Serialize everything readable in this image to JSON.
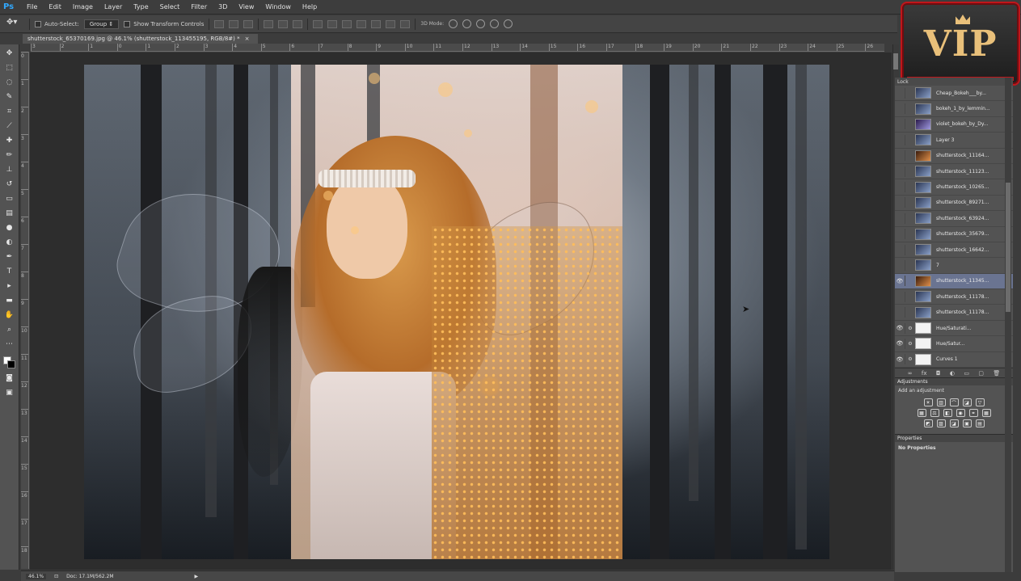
{
  "app": {
    "logo": "Ps"
  },
  "menu": [
    "File",
    "Edit",
    "Image",
    "Layer",
    "Type",
    "Select",
    "Filter",
    "3D",
    "View",
    "Window",
    "Help"
  ],
  "options": {
    "auto_select_label": "Auto-Select:",
    "auto_select_value": "Group",
    "show_transform_label": "Show Transform Controls",
    "mode_3d_label": "3D Mode:"
  },
  "document": {
    "tab_title": "shutterstock_65370169.jpg @ 46.1% (shutterstock_113455195, RGB/8#) *"
  },
  "rulers": {
    "horizontal": [
      "3",
      "2",
      "1",
      "0",
      "1",
      "2",
      "3",
      "4",
      "5",
      "6",
      "7",
      "8",
      "9",
      "10",
      "11",
      "12",
      "13",
      "14",
      "15",
      "16",
      "17",
      "18",
      "19",
      "20",
      "21",
      "22",
      "23",
      "24",
      "25",
      "26"
    ],
    "vertical": [
      "0",
      "1",
      "2",
      "3",
      "4",
      "5",
      "6",
      "7",
      "8",
      "9",
      "10",
      "11",
      "12",
      "13",
      "14",
      "15",
      "16",
      "17",
      "18"
    ]
  },
  "layers": [
    {
      "name": "Cheap_Bokeh___by...",
      "visible": false,
      "thumb": "blue"
    },
    {
      "name": "bokeh_1_by_lemmin...",
      "visible": false,
      "thumb": "blue"
    },
    {
      "name": "violet_bokeh_by_Dy...",
      "visible": false,
      "thumb": "purple"
    },
    {
      "name": "Layer 3",
      "visible": false,
      "thumb": "blue"
    },
    {
      "name": "shutterstock_11164...",
      "visible": false,
      "thumb": "warm"
    },
    {
      "name": "shutterstock_11123...",
      "visible": false,
      "thumb": "blue"
    },
    {
      "name": "shutterstock_10265...",
      "visible": false,
      "thumb": "blue"
    },
    {
      "name": "shutterstock_89271...",
      "visible": false,
      "thumb": "blue"
    },
    {
      "name": "shutterstock_63924...",
      "visible": false,
      "thumb": "blue"
    },
    {
      "name": "shutterstock_35679...",
      "visible": false,
      "thumb": "blue"
    },
    {
      "name": "shutterstock_16642...",
      "visible": false,
      "thumb": "blue"
    },
    {
      "name": "7",
      "visible": false,
      "thumb": "blue"
    },
    {
      "name": "shutterstock_11345...",
      "visible": true,
      "thumb": "warm",
      "selected": true
    },
    {
      "name": "shutterstock_11178...",
      "visible": false,
      "thumb": "blue"
    },
    {
      "name": "shutterstock_11178...",
      "visible": false,
      "thumb": "blue"
    },
    {
      "name": "Hue/Saturati...",
      "visible": true,
      "thumb": "white",
      "adjustment": true
    },
    {
      "name": "Hue/Satur...",
      "visible": true,
      "thumb": "white",
      "adjustment": true
    },
    {
      "name": "Curves 1",
      "visible": true,
      "thumb": "white",
      "adjustment": true
    }
  ],
  "adjustments": {
    "title": "Adjustments",
    "subtitle": "Add an adjustment"
  },
  "properties": {
    "title": "Properties",
    "body": "No Properties"
  },
  "status": {
    "zoom": "46.1%",
    "doc": "Doc: 17.1M/562.2M"
  },
  "badge": {
    "text": "VIP"
  },
  "colors": {
    "accent_selected": "#6a7491",
    "badge_red": "#c0161b",
    "badge_gold": "#e9c07a"
  }
}
